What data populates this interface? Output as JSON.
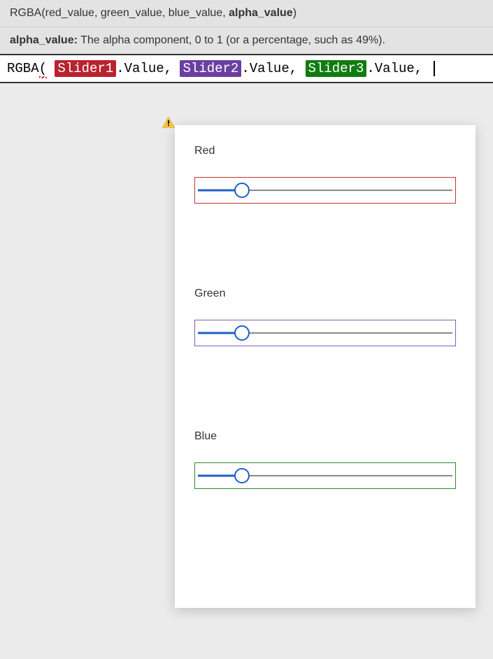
{
  "tooltip": {
    "signature": {
      "fn": "RGBA",
      "args_prefix": "(red_value, green_value, blue_value, ",
      "arg_active": "alpha_value",
      "args_suffix": ")"
    },
    "param": {
      "name": "alpha_value:",
      "desc": " The alpha component, 0 to 1 (or a percentage, such as 49%)."
    }
  },
  "formula": {
    "fn": "RGBA",
    "open": "(",
    "tok1": "Slider1",
    "val": ".Value",
    "comma": ", ",
    "tok2": "Slider2",
    "tok3": "Slider3"
  },
  "sliders": {
    "red": {
      "label": "Red",
      "pos_percent": 18,
      "border_color": "#c23434"
    },
    "green": {
      "label": "Green",
      "pos_percent": 18,
      "border_color": "#7a5fbf"
    },
    "blue": {
      "label": "Blue",
      "pos_percent": 18,
      "border_color": "#2e8b2e"
    }
  }
}
